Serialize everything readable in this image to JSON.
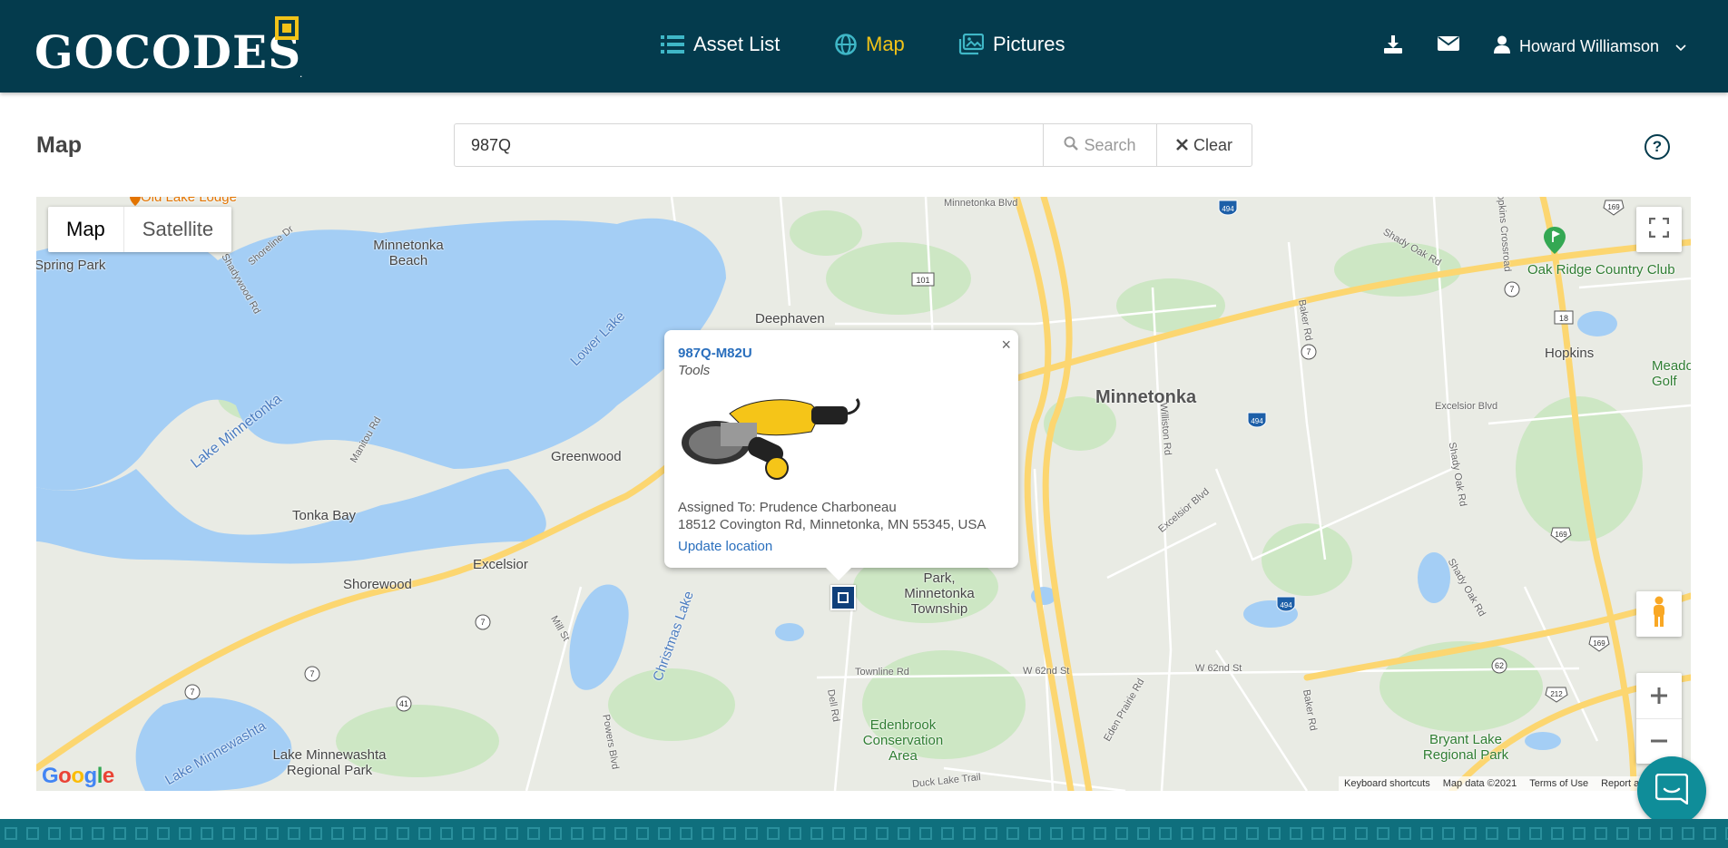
{
  "header": {
    "logo_text": "GOCODES",
    "logo_tm": ".",
    "nav": [
      {
        "label": "Asset List",
        "icon": "list-icon",
        "active": false
      },
      {
        "label": "Map",
        "icon": "globe-icon",
        "active": true
      },
      {
        "label": "Pictures",
        "icon": "images-icon",
        "active": false
      }
    ],
    "user_name": "Howard Williamson",
    "colors": {
      "bar": "#043b4d",
      "accent": "#f2c318"
    }
  },
  "page": {
    "title": "Map",
    "search": {
      "value": "987Q",
      "button": "Search",
      "clear": "Clear"
    }
  },
  "map": {
    "type_buttons": [
      "Map",
      "Satellite"
    ],
    "labels": {
      "old_lake_lodge": "Old Lake Lodge",
      "spring_park": "Spring Park",
      "minnetonka_beach": "Minnetonka Beach",
      "shoreline_dr": "Shoreline Dr",
      "shadywood_rd": "Shadywood Rd",
      "lower_lake": "Lower Lake",
      "deephaven": "Deephaven",
      "minnetonka": "Minnetonka",
      "lake_minnetonka": "Lake Minnetonka",
      "manitou_rd": "Manitou Rd",
      "greenwood": "Greenwood",
      "tonka_bay": "Tonka Bay",
      "excelsior": "Excelsior",
      "shorewood": "Shorewood",
      "christmas_lake": "Christmas Lake",
      "mill_st": "Mill St",
      "park_minnetonka": "Park, Minnetonka Township",
      "lake_minnewashta": "Lake Minnewashta",
      "lake_minnewashta_park": "Lake Minnewashta Regional Park",
      "powers_blvd": "Powers Blvd",
      "dell_rd": "Dell Rd",
      "townline_rd": "Townline Rd",
      "w62": "W 62nd St",
      "edenbrook": "Edenbrook Conservation Area",
      "duck_lake_trail": "Duck Lake Trail",
      "eden_prairie_rd": "Eden Prairie Rd",
      "baker_rd": "Baker Rd",
      "shady_oak_rd": "Shady Oak Rd",
      "excelsior_blvd": "Excelsior Blvd",
      "williston_rd": "Williston Rd",
      "minnetonka_blvd": "Minnetonka Blvd",
      "hopkins": "Hopkins",
      "oak_ridge": "Oak Ridge Country Club",
      "meadowbrook": "Meadowbrook Golf",
      "bryant_lake": "Bryant Lake Regional Park",
      "hopkins_crossroad": "Hopkins Crossroad"
    },
    "shields": [
      "494",
      "169",
      "101",
      "7",
      "18",
      "62",
      "212",
      "41"
    ],
    "popup": {
      "asset_id": "987Q-M82U",
      "category": "Tools",
      "assigned_to": "Assigned To: Prudence Charboneau",
      "address": "18512 Covington Rd, Minnetonka, MN 55345, USA",
      "update_link": "Update location"
    },
    "attribution": [
      "Keyboard shortcuts",
      "Map data ©2021",
      "Terms of Use",
      "Report a map error"
    ],
    "google": "Google"
  }
}
